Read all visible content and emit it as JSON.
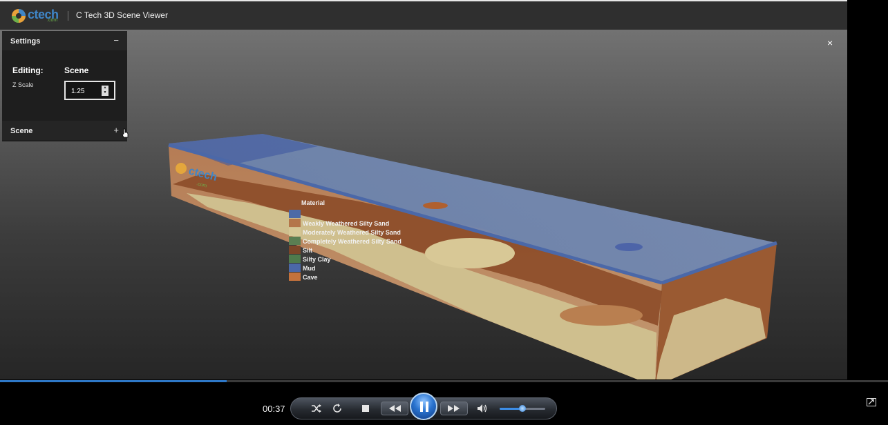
{
  "header": {
    "logo_text": "ctech",
    "logo_sub": ".com",
    "title": "C Tech 3D Scene Viewer"
  },
  "settings": {
    "title": "Settings",
    "collapse_symbol": "−",
    "editing_label": "Editing:",
    "editing_value": "Scene",
    "zscale_label": "Z Scale",
    "zscale_value": "1.25",
    "scene_title": "Scene",
    "expand_symbol": "+"
  },
  "viewer": {
    "close_symbol": "×",
    "legend_title": "Material",
    "model_logo": "ctech",
    "model_logo_sub": ".com",
    "legend": [
      {
        "label": "",
        "color": "#4d6aa6"
      },
      {
        "label": "Weakly Weathered Silty Sand",
        "color": "#b4764a"
      },
      {
        "label": "Moderately Weathered Silty Sand",
        "color": "#d6c896"
      },
      {
        "label": "Completely Weathered Silty Sand",
        "color": "#5a7e52"
      },
      {
        "label": "Silt",
        "color": "#7d4628"
      },
      {
        "label": "Silty Clay",
        "color": "#4f7a4c"
      },
      {
        "label": "Mud",
        "color": "#4b68a8"
      },
      {
        "label": "Cave",
        "color": "#c4723c"
      }
    ]
  },
  "player": {
    "time": "00:37",
    "progress": 0.255,
    "volume": 0.5
  },
  "colors": {
    "accent": "#2e78c8",
    "header_bg": "#2f2f2f",
    "panel_bg": "#1e1e1e"
  }
}
